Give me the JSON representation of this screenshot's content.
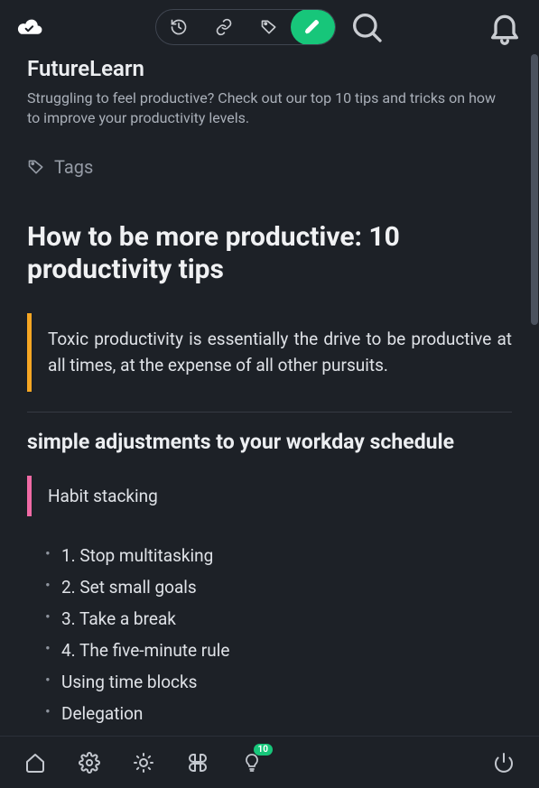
{
  "header": {
    "source_title": "FutureLearn",
    "source_desc": "Struggling to feel productive? Check out our top 10 tips and tricks on how to improve your productivity levels.",
    "tags_label": "Tags"
  },
  "article": {
    "title": "How to be more productive: 10 productivity tips",
    "quote1": "Toxic productivity is essentially the drive to be productive at all times, at the expense of all other pursuits.",
    "section_heading": "simple adjustments to your workday schedule",
    "quote2": "Habit stacking",
    "tips": [
      "1. Stop multitasking",
      "2. Set small goals",
      "3. Take a break",
      "4. The five-minute rule",
      "Using time blocks",
      "Delegation"
    ]
  },
  "bottombar": {
    "badge_count": "10"
  },
  "colors": {
    "accent_green": "#17c67a",
    "quote_orange": "#f5a623",
    "quote_pink": "#f06aa5",
    "bg": "#1d2127"
  }
}
